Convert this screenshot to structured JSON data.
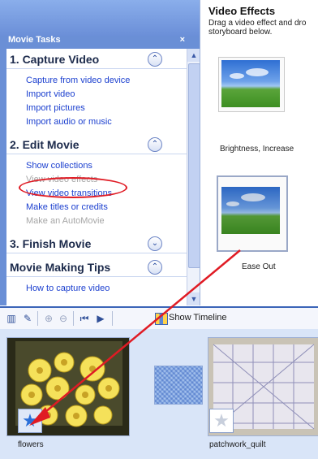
{
  "task_pane": {
    "header": "Movie Tasks",
    "close_glyph": "×",
    "sections": [
      {
        "title": "1. Capture Video",
        "chevron": "⌃",
        "links": [
          {
            "label": "Capture from video device",
            "enabled": true
          },
          {
            "label": "Import video",
            "enabled": true
          },
          {
            "label": "Import pictures",
            "enabled": true
          },
          {
            "label": "Import audio or music",
            "enabled": true
          }
        ]
      },
      {
        "title": "2. Edit Movie",
        "chevron": "⌃",
        "links": [
          {
            "label": "Show collections",
            "enabled": true
          },
          {
            "label": "View video effects",
            "enabled": false
          },
          {
            "label": "View video transitions",
            "enabled": true
          },
          {
            "label": "Make titles or credits",
            "enabled": true
          },
          {
            "label": "Make an AutoMovie",
            "enabled": false
          }
        ]
      },
      {
        "title": "3. Finish Movie",
        "chevron": "⌄",
        "links": []
      },
      {
        "title": "Movie Making Tips",
        "chevron": "⌃",
        "links": [
          {
            "label": "How to capture video",
            "enabled": true
          }
        ]
      }
    ]
  },
  "effects_pane": {
    "title": "Video Effects",
    "description": "Drag a video effect and dro",
    "description_line2": "storyboard below.",
    "effects": [
      {
        "label": "Brightness, Increase"
      },
      {
        "label": "Ease Out"
      }
    ]
  },
  "toolbar": {
    "show_timeline_label": "Show Timeline"
  },
  "storyboard": {
    "clips": [
      {
        "label": "flowers"
      },
      {
        "label": "patchwork_quilt"
      }
    ]
  },
  "colors": {
    "highlight": "#e01b24",
    "link": "#1b3fcf",
    "disabled_link": "#a6a6a6"
  }
}
